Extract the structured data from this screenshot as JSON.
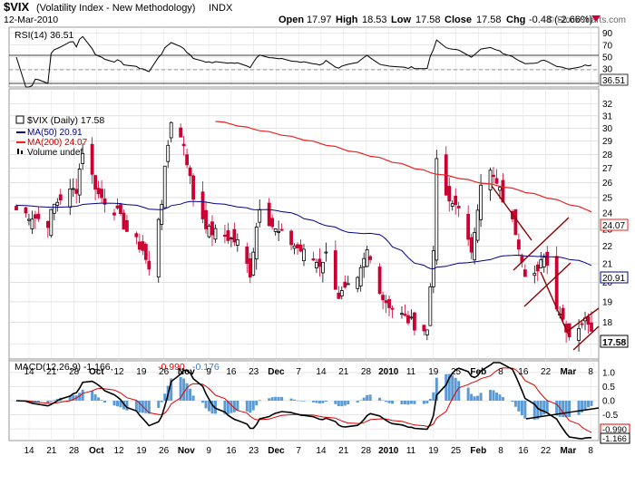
{
  "header": {
    "symbol": "$VIX",
    "name": "(Volatility Index - New Methodology)",
    "exchange": "INDX",
    "date": "12-Mar-2010",
    "watermark": "© StockCharts.com",
    "open_label": "Open",
    "open": "17.97",
    "high_label": "High",
    "high": "18.53",
    "low_label": "Low",
    "low": "17.58",
    "close_label": "Close",
    "close": "17.58",
    "chg_label": "Chg",
    "chg": "-0.48 (-2.66%)"
  },
  "colors": {
    "up": "#000000",
    "down": "#cc0033",
    "ma50": "#00008b",
    "ma200": "#ee2222",
    "macd": "#000000",
    "signal": "#dd0000",
    "hist": "#5b9bd5",
    "trend": "#8b0000",
    "grid": "#cfcfcf"
  },
  "rsi_panel": {
    "legend": "RSI(14) 36.51",
    "current_label": "36.51",
    "ticks": [
      "90",
      "70",
      "50",
      "30",
      "10"
    ]
  },
  "price_panel": {
    "legend_main": "$VIX (Daily) 17.58",
    "legend_ma50": "MA(50) 20.91",
    "legend_ma200": "MA(200) 24.07",
    "legend_volume": "Volume undef",
    "ma50_label": "20.91",
    "ma200_label": "24.07",
    "close_label": "17.58",
    "ticks": [
      "32",
      "31",
      "30",
      "29",
      "28",
      "27",
      "26",
      "25",
      "24",
      "23",
      "22",
      "21",
      "20",
      "19",
      "18",
      "17"
    ]
  },
  "macd_panel": {
    "legend_macd": "MACD(12,26,9) -1.166,",
    "legend_signal": "-0.990,",
    "legend_hist": "-0.176",
    "macd_label": "-1.166",
    "signal_label": "-0.990",
    "ticks": [
      "1.0",
      "0.5",
      "0.0",
      "-0.5",
      "-1.0"
    ]
  },
  "x_axis": {
    "labels": [
      "14",
      "21",
      "28",
      "Oct",
      "12",
      "19",
      "26",
      "Nov",
      "9",
      "16",
      "23",
      "Dec",
      "7",
      "14",
      "21",
      "28",
      "2010",
      "11",
      "19",
      "25",
      "Feb",
      "8",
      "16",
      "22",
      "Mar",
      "8"
    ]
  },
  "chart_data": {
    "type": "candlestick",
    "x_range": [
      "2009-09-11",
      "2010-03-12"
    ],
    "price_ylim": [
      16.5,
      32.5
    ],
    "price_scale": "log",
    "rsi_ylim": [
      0,
      100
    ],
    "macd_ylim": [
      -1.35,
      1.35
    ],
    "current": {
      "open": 17.97,
      "high": 18.53,
      "low": 17.58,
      "close": 17.58,
      "chg": -0.48,
      "chg_pct": -2.66
    },
    "ma50_last": 20.91,
    "ma200_last": 24.07,
    "rsi_last": 36.51,
    "macd_last": -1.166,
    "signal_last": -0.99,
    "hist_last": -0.176,
    "close_anchors": [
      [
        "2009-09-11",
        24.2
      ],
      [
        "2009-09-16",
        23.8
      ],
      [
        "2009-09-21",
        23.4
      ],
      [
        "2009-09-23",
        24.5
      ],
      [
        "2009-09-25",
        25.0
      ],
      [
        "2009-09-30",
        25.6
      ],
      [
        "2009-10-02",
        28.3
      ],
      [
        "2009-10-07",
        25.2
      ],
      [
        "2009-10-13",
        24.0
      ],
      [
        "2009-10-16",
        22.9
      ],
      [
        "2009-10-21",
        21.8
      ],
      [
        "2009-10-23",
        20.6
      ],
      [
        "2009-10-27",
        24.8
      ],
      [
        "2009-10-30",
        30.7
      ],
      [
        "2009-11-03",
        28.8
      ],
      [
        "2009-11-06",
        25.0
      ],
      [
        "2009-11-11",
        22.9
      ],
      [
        "2009-11-16",
        22.6
      ],
      [
        "2009-11-20",
        22.2
      ],
      [
        "2009-11-24",
        20.5
      ],
      [
        "2009-11-27",
        24.5
      ],
      [
        "2009-12-02",
        22.9
      ],
      [
        "2009-12-07",
        22.2
      ],
      [
        "2009-12-11",
        21.6
      ],
      [
        "2009-12-16",
        21.0
      ],
      [
        "2009-12-18",
        21.5
      ],
      [
        "2009-12-22",
        19.3
      ],
      [
        "2009-12-28",
        20.0
      ],
      [
        "2009-12-31",
        21.7
      ],
      [
        "2010-01-05",
        19.2
      ],
      [
        "2010-01-08",
        18.7
      ],
      [
        "2010-01-12",
        18.2
      ],
      [
        "2010-01-15",
        17.9
      ],
      [
        "2010-01-19",
        17.6
      ],
      [
        "2010-01-21",
        22.0
      ],
      [
        "2010-01-22",
        27.3
      ],
      [
        "2010-01-26",
        24.5
      ],
      [
        "2010-01-29",
        24.6
      ],
      [
        "2010-02-02",
        21.4
      ],
      [
        "2010-02-05",
        26.1
      ],
      [
        "2010-02-08",
        26.7
      ],
      [
        "2010-02-11",
        25.4
      ],
      [
        "2010-02-16",
        22.9
      ],
      [
        "2010-02-19",
        20.6
      ],
      [
        "2010-02-23",
        20.4
      ],
      [
        "2010-02-25",
        21.6
      ],
      [
        "2010-03-01",
        18.9
      ],
      [
        "2010-03-05",
        17.4
      ],
      [
        "2010-03-09",
        18.0
      ],
      [
        "2010-03-11",
        18.1
      ],
      [
        "2010-03-12",
        17.58
      ]
    ]
  }
}
